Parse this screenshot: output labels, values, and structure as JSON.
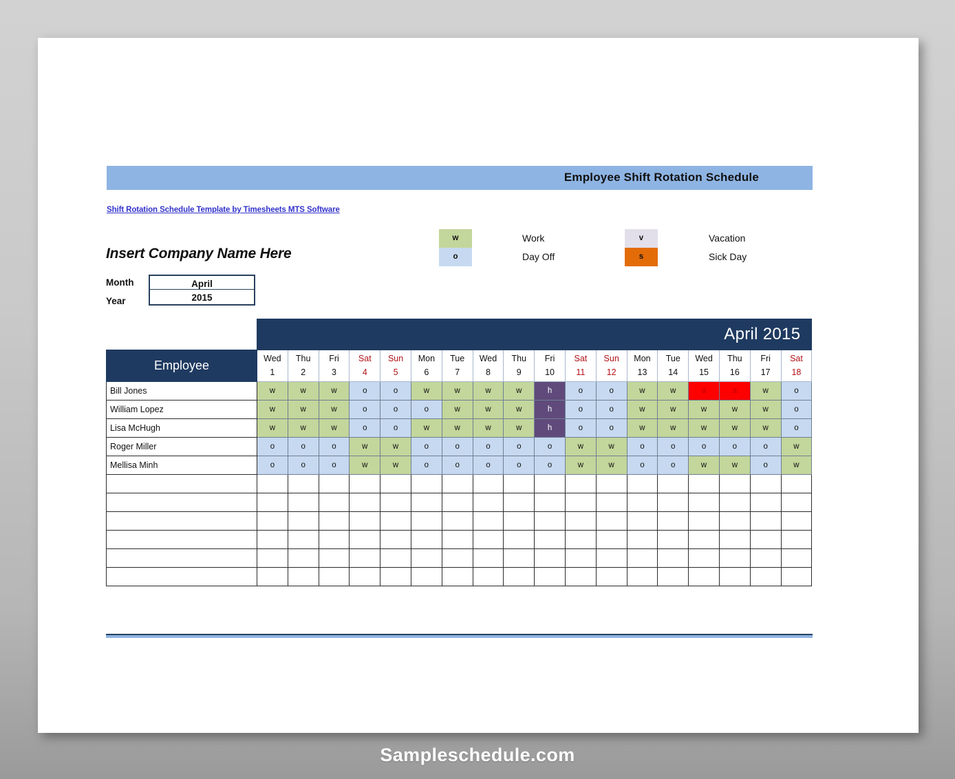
{
  "document": {
    "banner_title": "Employee Shift Rotation Schedule",
    "template_link": "Shift Rotation Schedule Template by Timesheets MTS Software",
    "company_name": "Insert Company Name Here",
    "watermark": "Sampleschedule.com"
  },
  "fields": {
    "month_label": "Month",
    "month_value": "April",
    "year_label": "Year",
    "year_value": "2015"
  },
  "legend": {
    "items": [
      {
        "code": "w",
        "label": "Work",
        "color": "#c3d69b"
      },
      {
        "code": "o",
        "label": "Day Off",
        "color": "#c6d9f0"
      },
      {
        "code": "v",
        "label": "Vacation",
        "color": "#e3dfea"
      },
      {
        "code": "s",
        "label": "Sick Day",
        "color": "#e36c09"
      }
    ]
  },
  "schedule": {
    "month_title": "April 2015",
    "employee_header": "Employee",
    "days": [
      {
        "dow": "Wed",
        "num": "1",
        "weekend": false
      },
      {
        "dow": "Thu",
        "num": "2",
        "weekend": false
      },
      {
        "dow": "Fri",
        "num": "3",
        "weekend": false
      },
      {
        "dow": "Sat",
        "num": "4",
        "weekend": true
      },
      {
        "dow": "Sun",
        "num": "5",
        "weekend": true
      },
      {
        "dow": "Mon",
        "num": "6",
        "weekend": false
      },
      {
        "dow": "Tue",
        "num": "7",
        "weekend": false
      },
      {
        "dow": "Wed",
        "num": "8",
        "weekend": false
      },
      {
        "dow": "Thu",
        "num": "9",
        "weekend": false
      },
      {
        "dow": "Fri",
        "num": "10",
        "weekend": false
      },
      {
        "dow": "Sat",
        "num": "11",
        "weekend": true
      },
      {
        "dow": "Sun",
        "num": "12",
        "weekend": true
      },
      {
        "dow": "Mon",
        "num": "13",
        "weekend": false
      },
      {
        "dow": "Tue",
        "num": "14",
        "weekend": false
      },
      {
        "dow": "Wed",
        "num": "15",
        "weekend": false
      },
      {
        "dow": "Thu",
        "num": "16",
        "weekend": false
      },
      {
        "dow": "Fri",
        "num": "17",
        "weekend": false
      },
      {
        "dow": "Sat",
        "num": "18",
        "weekend": true
      }
    ],
    "rows": [
      {
        "employee": "Bill Jones",
        "shifts": [
          "w",
          "w",
          "w",
          "o",
          "o",
          "w",
          "w",
          "w",
          "w",
          "h",
          "o",
          "o",
          "w",
          "w",
          "a",
          "a",
          "w",
          "o"
        ]
      },
      {
        "employee": "William Lopez",
        "shifts": [
          "w",
          "w",
          "w",
          "o",
          "o",
          "o",
          "w",
          "w",
          "w",
          "h",
          "o",
          "o",
          "w",
          "w",
          "w",
          "w",
          "w",
          "o"
        ]
      },
      {
        "employee": "Lisa McHugh",
        "shifts": [
          "w",
          "w",
          "w",
          "o",
          "o",
          "w",
          "w",
          "w",
          "w",
          "h",
          "o",
          "o",
          "w",
          "w",
          "w",
          "w",
          "w",
          "o"
        ]
      },
      {
        "employee": "Roger Miller",
        "shifts": [
          "o",
          "o",
          "o",
          "w",
          "w",
          "o",
          "o",
          "o",
          "o",
          "o",
          "w",
          "w",
          "o",
          "o",
          "o",
          "o",
          "o",
          "w"
        ]
      },
      {
        "employee": "Mellisa Minh",
        "shifts": [
          "o",
          "o",
          "o",
          "w",
          "w",
          "o",
          "o",
          "o",
          "o",
          "o",
          "w",
          "w",
          "o",
          "o",
          "w",
          "w",
          "o",
          "w"
        ]
      },
      {
        "employee": "",
        "shifts": [
          "",
          "",
          "",
          "",
          "",
          "",
          "",
          "",
          "",
          "",
          "",
          "",
          "",
          "",
          "",
          "",
          "",
          ""
        ]
      },
      {
        "employee": "",
        "shifts": [
          "",
          "",
          "",
          "",
          "",
          "",
          "",
          "",
          "",
          "",
          "",
          "",
          "",
          "",
          "",
          "",
          "",
          ""
        ]
      },
      {
        "employee": "",
        "shifts": [
          "",
          "",
          "",
          "",
          "",
          "",
          "",
          "",
          "",
          "",
          "",
          "",
          "",
          "",
          "",
          "",
          "",
          ""
        ]
      },
      {
        "employee": "",
        "shifts": [
          "",
          "",
          "",
          "",
          "",
          "",
          "",
          "",
          "",
          "",
          "",
          "",
          "",
          "",
          "",
          "",
          "",
          ""
        ]
      },
      {
        "employee": "",
        "shifts": [
          "",
          "",
          "",
          "",
          "",
          "",
          "",
          "",
          "",
          "",
          "",
          "",
          "",
          "",
          "",
          "",
          "",
          ""
        ]
      },
      {
        "employee": "",
        "shifts": [
          "",
          "",
          "",
          "",
          "",
          "",
          "",
          "",
          "",
          "",
          "",
          "",
          "",
          "",
          "",
          "",
          "",
          ""
        ]
      }
    ]
  }
}
